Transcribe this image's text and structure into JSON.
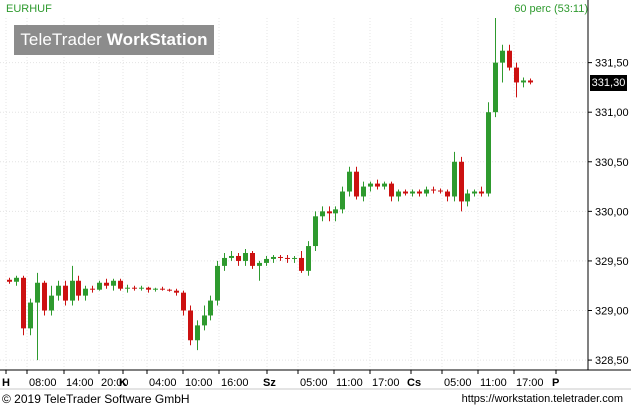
{
  "header": {
    "symbol": "EURHUF",
    "period": "60 perc (53:11)",
    "logo_light": "TeleTrader ",
    "logo_bold": "WorkStation"
  },
  "footer": {
    "copyright": "© 2019 TeleTrader Software GmbH",
    "url": "https://workstation.teletrader.com"
  },
  "colors": {
    "up": "#2e9a2e",
    "down": "#cc1111",
    "grid": "#e4e4e4",
    "axis": "#000000"
  },
  "chart_data": {
    "type": "candlestick",
    "ylim": [
      328.4,
      331.95
    ],
    "y_ticks": [
      "331,50",
      "331,00",
      "330,50",
      "330,00",
      "329,50",
      "329,00",
      "328,50"
    ],
    "y_tick_values": [
      331.5,
      331.0,
      330.5,
      330.0,
      329.5,
      329.0,
      328.5
    ],
    "x_tick_labels": [
      "H",
      "08:00",
      "14:00",
      "20:00",
      "K",
      "04:00",
      "10:00",
      "16:00",
      "Sz",
      "05:00",
      "11:00",
      "17:00",
      "Cs",
      "05:00",
      "11:00",
      "17:00",
      "P"
    ],
    "last_price": "331,30",
    "grid": true,
    "candles": [
      [
        329.31,
        329.33,
        329.27,
        329.29
      ],
      [
        329.29,
        329.35,
        329.25,
        329.33
      ],
      [
        329.33,
        329.35,
        328.75,
        328.82
      ],
      [
        328.82,
        329.12,
        328.75,
        329.08
      ],
      [
        329.08,
        329.38,
        328.5,
        329.28
      ],
      [
        329.28,
        329.3,
        328.95,
        329.0
      ],
      [
        329.0,
        329.25,
        328.95,
        329.15
      ],
      [
        329.15,
        329.3,
        329.1,
        329.25
      ],
      [
        329.25,
        329.3,
        329.05,
        329.1
      ],
      [
        329.1,
        329.45,
        329.05,
        329.3
      ],
      [
        329.3,
        329.35,
        329.1,
        329.15
      ],
      [
        329.15,
        329.25,
        329.1,
        329.22
      ],
      [
        329.22,
        329.25,
        329.18,
        329.21
      ],
      [
        329.21,
        329.3,
        329.2,
        329.28
      ],
      [
        329.28,
        329.32,
        329.22,
        329.25
      ],
      [
        329.25,
        329.32,
        329.2,
        329.3
      ],
      [
        329.3,
        329.32,
        329.2,
        329.22
      ],
      [
        329.22,
        329.26,
        329.18,
        329.23
      ],
      [
        329.23,
        329.25,
        329.2,
        329.22
      ],
      [
        329.22,
        329.25,
        329.2,
        329.23
      ],
      [
        329.23,
        329.24,
        329.18,
        329.21
      ],
      [
        329.21,
        329.23,
        329.19,
        329.22
      ],
      [
        329.22,
        329.24,
        329.2,
        329.21
      ],
      [
        329.21,
        329.22,
        329.19,
        329.2
      ],
      [
        329.2,
        329.22,
        329.15,
        329.18
      ],
      [
        329.18,
        329.2,
        328.95,
        329.0
      ],
      [
        329.0,
        329.05,
        328.65,
        328.7
      ],
      [
        328.7,
        328.9,
        328.6,
        328.85
      ],
      [
        328.85,
        329.05,
        328.8,
        328.95
      ],
      [
        328.95,
        329.15,
        328.9,
        329.1
      ],
      [
        329.1,
        329.5,
        329.05,
        329.45
      ],
      [
        329.45,
        329.58,
        329.4,
        329.53
      ],
      [
        329.53,
        329.6,
        329.5,
        329.55
      ],
      [
        329.55,
        329.58,
        329.45,
        329.5
      ],
      [
        329.5,
        329.62,
        329.45,
        329.58
      ],
      [
        329.58,
        329.6,
        329.42,
        329.45
      ],
      [
        329.45,
        329.5,
        329.3,
        329.48
      ],
      [
        329.48,
        329.55,
        329.45,
        329.52
      ],
      [
        329.52,
        329.56,
        329.48,
        329.54
      ],
      [
        329.54,
        329.56,
        329.5,
        329.53
      ],
      [
        329.53,
        329.56,
        329.48,
        329.52
      ],
      [
        329.52,
        329.55,
        329.48,
        329.53
      ],
      [
        329.53,
        329.6,
        329.38,
        329.4
      ],
      [
        329.4,
        329.7,
        329.35,
        329.65
      ],
      [
        329.65,
        330.0,
        329.6,
        329.95
      ],
      [
        329.95,
        330.05,
        329.9,
        330.0
      ],
      [
        330.0,
        330.05,
        329.9,
        329.98
      ],
      [
        329.98,
        330.05,
        329.9,
        330.02
      ],
      [
        330.02,
        330.25,
        329.98,
        330.2
      ],
      [
        330.2,
        330.45,
        330.15,
        330.4
      ],
      [
        330.4,
        330.45,
        330.12,
        330.15
      ],
      [
        330.15,
        330.3,
        330.1,
        330.25
      ],
      [
        330.25,
        330.3,
        330.2,
        330.28
      ],
      [
        330.28,
        330.32,
        330.22,
        330.25
      ],
      [
        330.25,
        330.3,
        330.22,
        330.28
      ],
      [
        330.28,
        330.3,
        330.1,
        330.15
      ],
      [
        330.15,
        330.22,
        330.1,
        330.2
      ],
      [
        330.2,
        330.22,
        330.16,
        330.18
      ],
      [
        330.18,
        330.22,
        330.15,
        330.2
      ],
      [
        330.2,
        330.22,
        330.15,
        330.18
      ],
      [
        330.18,
        330.25,
        330.15,
        330.22
      ],
      [
        330.22,
        330.25,
        330.18,
        330.21
      ],
      [
        330.21,
        330.23,
        330.18,
        330.2
      ],
      [
        330.2,
        330.22,
        330.1,
        330.15
      ],
      [
        330.15,
        330.6,
        330.1,
        330.5
      ],
      [
        330.5,
        330.55,
        330.0,
        330.1
      ],
      [
        330.1,
        330.22,
        330.05,
        330.18
      ],
      [
        330.18,
        330.22,
        330.15,
        330.2
      ],
      [
        330.2,
        330.25,
        330.15,
        330.18
      ],
      [
        330.18,
        331.1,
        330.15,
        331.0
      ],
      [
        331.0,
        331.95,
        330.95,
        331.5
      ],
      [
        331.5,
        331.68,
        331.3,
        331.62
      ],
      [
        331.62,
        331.68,
        331.42,
        331.45
      ],
      [
        331.45,
        331.5,
        331.15,
        331.3
      ],
      [
        331.3,
        331.35,
        331.25,
        331.32
      ],
      [
        331.32,
        331.34,
        331.28,
        331.3
      ]
    ]
  }
}
